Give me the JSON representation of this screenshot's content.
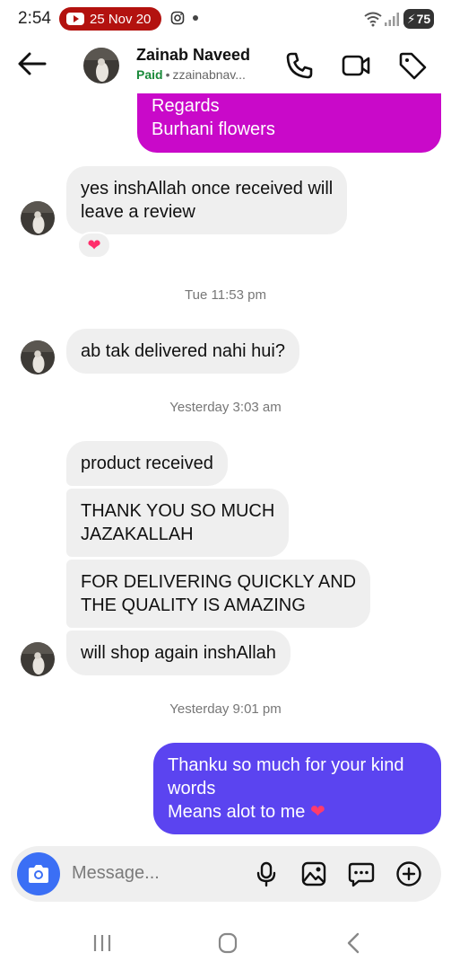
{
  "status_bar": {
    "time": "2:54",
    "notification_pill": "25 Nov 20",
    "battery": "75"
  },
  "header": {
    "contact_name": "Zainab Naveed",
    "status": "Paid",
    "username": "zzainabnav..."
  },
  "messages": {
    "prev_outgoing_lines": [
      "Regards",
      "Burhani flowers"
    ],
    "m1_lines": [
      "yes inshAllah once received will",
      "leave a review"
    ],
    "m1_reaction": "❤",
    "ts1": "Tue 11:53 pm",
    "m2": "ab tak delivered nahi hui?",
    "ts2": "Yesterday 3:03 am",
    "m3": "product received",
    "m4_lines": [
      "THANK YOU SO MUCH",
      "JAZAKALLAH"
    ],
    "m5_lines": [
      "FOR DELIVERING QUICKLY AND",
      "THE QUALITY IS AMAZING"
    ],
    "m6": "will shop again inshAllah",
    "ts3": "Yesterday 9:01 pm",
    "out_lines": [
      "Thanku so much for your kind",
      "words",
      "Means alot to me"
    ]
  },
  "composer": {
    "placeholder": "Message..."
  },
  "colors": {
    "outgoing_previous": "#c909c9",
    "outgoing_last": "#5b44f0",
    "incoming": "#efefef",
    "camera_button": "#3b6ff5",
    "paid_status": "#1a8a3a"
  },
  "icons": [
    "back-arrow-icon",
    "phone-icon",
    "video-call-icon",
    "tag-icon",
    "camera-icon",
    "microphone-icon",
    "gallery-icon",
    "sticker-icon",
    "add-icon",
    "heart-icon",
    "recents-icon",
    "home-icon",
    "back-nav-icon"
  ]
}
